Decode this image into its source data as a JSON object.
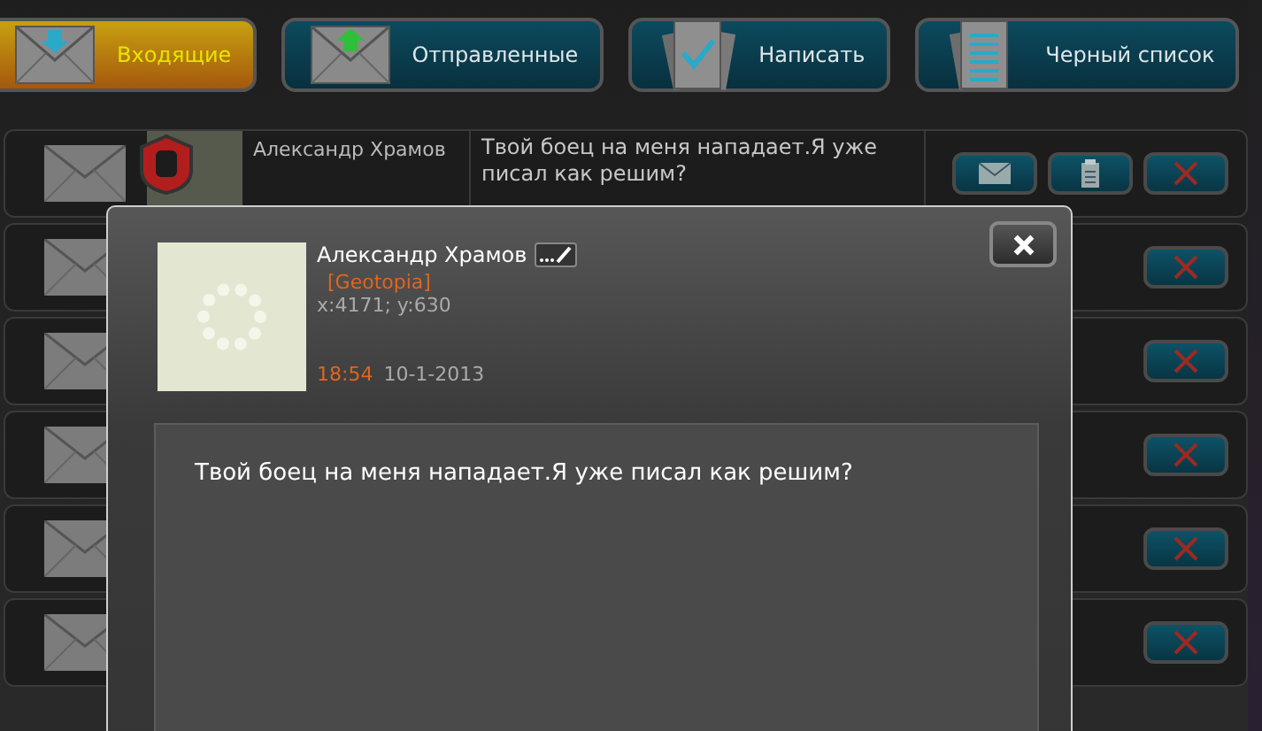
{
  "tabs": [
    {
      "label": "Входящие",
      "selected": true
    },
    {
      "label": "Отправленные",
      "selected": false
    },
    {
      "label": "Написать",
      "selected": false
    },
    {
      "label": "Черный список",
      "selected": false
    }
  ],
  "messages": [
    {
      "kind": "open",
      "sender": "Александр Храмов",
      "preview": "Твой боец на меня нападает.Я уже писал как решим?"
    },
    {
      "kind": "covered"
    },
    {
      "kind": "covered"
    },
    {
      "kind": "covered"
    },
    {
      "kind": "covered"
    },
    {
      "kind": "covered"
    }
  ],
  "dialog": {
    "sender": "Александр Храмов",
    "clan": "[Geotopia]",
    "coords": "x:4171; y:630",
    "time": "18:54",
    "date": "10-1-2013",
    "body": "Твой боец на меня нападает.Я уже писал как решим?"
  }
}
